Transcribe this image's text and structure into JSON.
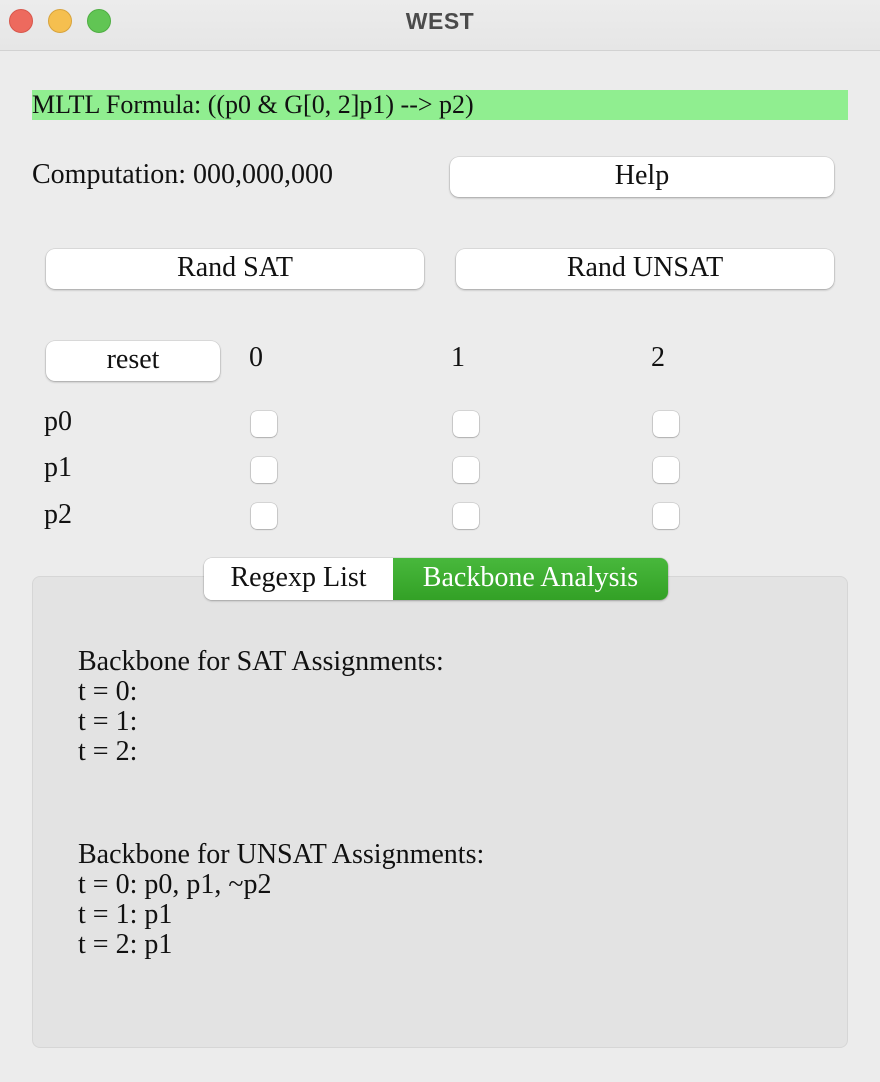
{
  "window": {
    "title": "WEST"
  },
  "formula": {
    "text": "MLTL Formula: ((p0 & G[0, 2]p1) --> p2)",
    "highlight_color": "#90ee90"
  },
  "computation": {
    "text": "Computation: 000,000,000"
  },
  "buttons": {
    "help": "Help",
    "rand_sat": "Rand SAT",
    "rand_unsat": "Rand UNSAT",
    "reset": "reset"
  },
  "grid": {
    "time_headers": [
      "0",
      "1",
      "2"
    ],
    "rows": [
      {
        "label": "p0",
        "checked": [
          false,
          false,
          false
        ]
      },
      {
        "label": "p1",
        "checked": [
          false,
          false,
          false
        ]
      },
      {
        "label": "p2",
        "checked": [
          false,
          false,
          false
        ]
      }
    ]
  },
  "tabs": [
    {
      "label": "Regexp List",
      "selected": false
    },
    {
      "label": "Backbone Analysis",
      "selected": true
    }
  ],
  "tab_accent_color": "#3aa82e",
  "backbone": {
    "sat_title": "Backbone for SAT Assignments:",
    "sat_lines": [
      "t = 0:",
      "t = 1:",
      "t = 2:"
    ],
    "unsat_title": "Backbone for UNSAT Assignments:",
    "unsat_lines": [
      "t = 0: p0, p1, ~p2",
      "t = 1: p1",
      "t = 2: p1"
    ]
  }
}
